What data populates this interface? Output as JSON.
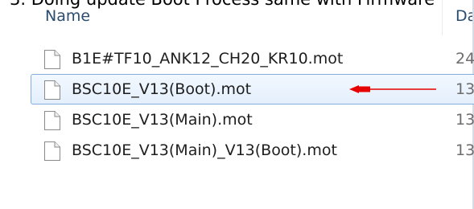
{
  "document": {
    "heading": "3. Doing update Boot Process same with Firmware"
  },
  "columns": {
    "name": "Name",
    "date": "Da"
  },
  "files": [
    {
      "name": "B1E#TF10_ANK12_CH20_KR10.mot",
      "date": "24",
      "selected": false
    },
    {
      "name": "BSC10E_V13(Boot).mot",
      "date": "13",
      "selected": true
    },
    {
      "name": "BSC10E_V13(Main).mot",
      "date": "13",
      "selected": false
    },
    {
      "name": "BSC10E_V13(Main)_V13(Boot).mot",
      "date": "13",
      "selected": false
    }
  ],
  "annotation": {
    "arrow_color": "#e60000",
    "points_to": "BSC10E_V13(Boot).mot"
  },
  "colors": {
    "selection_border": "#84acdd",
    "selection_fill": "#e4effc",
    "header_text": "#2b4d6e"
  },
  "icons": {
    "file": "file-icon",
    "arrow": "red-arrow-annotation"
  }
}
